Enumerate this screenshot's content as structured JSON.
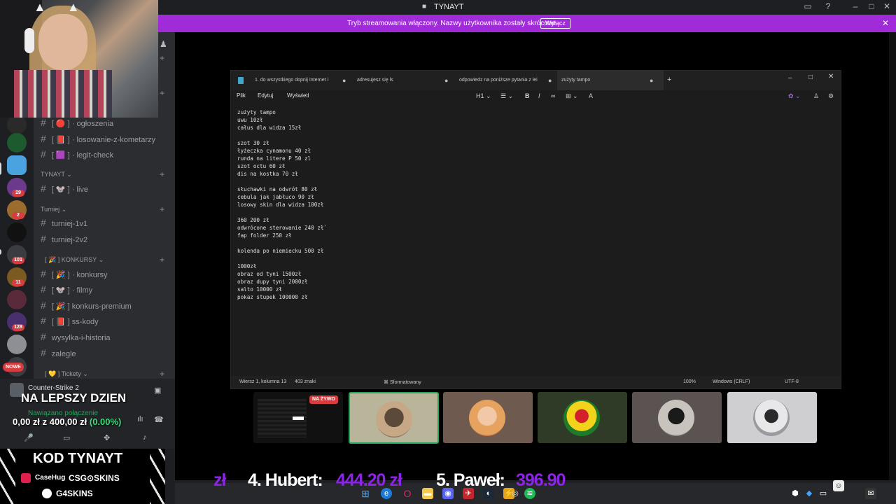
{
  "window": {
    "title": "TYNAYT"
  },
  "banner": {
    "text": "Tryb streamowania włączony. Nazwy użytkownika zostały skrócone.",
    "button": "Wyłącz"
  },
  "rail": {
    "badges": [
      "29",
      "2",
      "101",
      "11",
      "128"
    ],
    "new_label": "NOWE"
  },
  "channels": {
    "items": [
      {
        "name": "ogłoszenia",
        "prefix": "[ 🔴 ] ·"
      },
      {
        "name": "losowanie-z-kometarzy",
        "prefix": "[ 📕 ] ·"
      },
      {
        "name": "legit-check",
        "prefix": "[ 🟪 ] ·"
      }
    ],
    "cat_tynayt": "TYNAYT",
    "tynayt_items": [
      {
        "name": "live",
        "prefix": "[ 🐭 ] ·"
      }
    ],
    "cat_turniej": "Turniej",
    "turniej_items": [
      {
        "name": "turniej-1v1"
      },
      {
        "name": "turniej-2v2"
      }
    ],
    "cat_konkursy": "KONKURSY",
    "cat_konkursy_prefix": "[ 🎉 ]",
    "konkursy_items": [
      {
        "name": "konkursy",
        "prefix": "[ 🎉 ] ·"
      },
      {
        "name": "filmy",
        "prefix": "[ 🐭 ] ·"
      },
      {
        "name": "konkurs-premium",
        "prefix": "[ 🎉 ]"
      },
      {
        "name": "ss-kody",
        "prefix": "[ 📕 ]"
      },
      {
        "name": "wysylka-i-historia"
      },
      {
        "name": "zalegle"
      }
    ],
    "cat_tickety": "Tickety",
    "cat_tickety_prefix": "[ 💛 ]"
  },
  "voice": {
    "game": "Counter-Strike 2",
    "overlay": "NA LEPSZY DZIEN",
    "status": "Nawiązano połączenie",
    "money": "0,00 zł z 400,00 zł",
    "pct": "(0.00%)"
  },
  "code": {
    "title": "KOD TYNAYT",
    "sponsor1": "CaseHug",
    "sponsor2": "CSG⊙SKINS",
    "sponsor3": "G4SKINS"
  },
  "notepad": {
    "tabs": [
      "1. do wszystkiego dopnij Internet i",
      "adresujesz się ls",
      "odpowiedz na poniższe pytania z lei",
      "zużyty tampo"
    ],
    "menu": [
      "Plik",
      "Edytuj",
      "Wyświetl"
    ],
    "heading": "H1",
    "text": "zużyty tampo\nuwu 10zł\ncałus dla widza 15zł\n\nszot 30 zł\nłyżeczka cynamonu 40 zł\nrunda na litere P 50 zl\nszot octu 60 zł\ndis na kostka 70 zł\n\nsłuchawki na odwrót 80 zł\ncebula jak jabłuco 90 zł\nlosowy skin dla widza 100zł\n\n360 200 zł\nodwrócone sterowanie 240 zł`\nfap folder 250 zł\n\nkolenda po niemiecku 500 zł\n\n1000zł\nobraz od tyni 1500zł\nobraz dupy tyni 2000zł\nsalto 10000 zł\npokaz stupek 100000 zł",
    "status": {
      "position": "Wiersz 1, kolumna 13",
      "chars": "403 znaki",
      "format": "Sformatowany",
      "zoom": "100%",
      "eol": "Windows (CRLF)",
      "enc": "UTF-8"
    }
  },
  "tiles": {
    "live_label": "NA ŻYWO"
  },
  "ticker": {
    "lead": "zł",
    "item4_name": "4. Hubert:",
    "item4_value": "444.20 zł",
    "item5_name": "5. Paweł:",
    "item5_value": "396.90"
  },
  "colors": {
    "accent": "#a02bd8",
    "ticker_value": "#8b24e6",
    "live_red": "#d83c3e"
  }
}
